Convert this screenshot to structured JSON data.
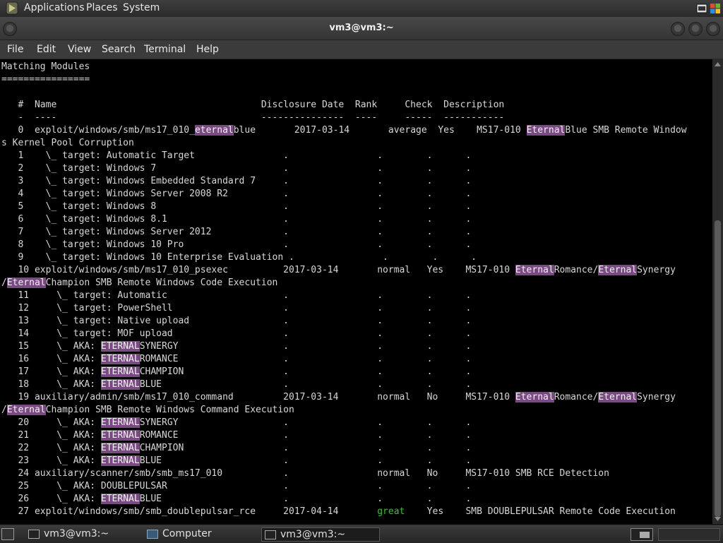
{
  "top_panel": {
    "menus": [
      "Applications",
      "Places",
      "System"
    ]
  },
  "window": {
    "title": "vm3@vm3:~"
  },
  "menubar": {
    "items": [
      "File",
      "Edit",
      "View",
      "Search",
      "Terminal",
      "Help"
    ]
  },
  "terminal": {
    "lines": [
      [
        {
          "t": "Matching Modules"
        }
      ],
      [
        {
          "t": "================"
        }
      ],
      [
        {
          "t": ""
        }
      ],
      [
        {
          "t": "   #  Name                                     Disclosure Date  Rank     Check  Description"
        }
      ],
      [
        {
          "t": "   -  ----                                     ---------------  ----     -----  -----------"
        }
      ],
      [
        {
          "t": "   0  exploit/windows/smb/ms17_010_"
        },
        {
          "t": "eternal",
          "c": "hl"
        },
        {
          "t": "blue       2017-03-14       average  Yes    MS17-010 "
        },
        {
          "t": "Eternal",
          "c": "hl"
        },
        {
          "t": "Blue SMB Remote Window"
        }
      ],
      [
        {
          "t": "s Kernel Pool Corruption"
        }
      ],
      [
        {
          "t": "   1    \\_ target: Automatic Target                .                .        .      ."
        }
      ],
      [
        {
          "t": "   2    \\_ target: Windows 7                       .                .        .      ."
        }
      ],
      [
        {
          "t": "   3    \\_ target: Windows Embedded Standard 7     .                .        .      ."
        }
      ],
      [
        {
          "t": "   4    \\_ target: Windows Server 2008 R2          .                .        .      ."
        }
      ],
      [
        {
          "t": "   5    \\_ target: Windows 8                       .                .        .      ."
        }
      ],
      [
        {
          "t": "   6    \\_ target: Windows 8.1                     .                .        .      ."
        }
      ],
      [
        {
          "t": "   7    \\_ target: Windows Server 2012             .                .        .      ."
        }
      ],
      [
        {
          "t": "   8    \\_ target: Windows 10 Pro                  .                .        .      ."
        }
      ],
      [
        {
          "t": "   9    \\_ target: Windows 10 Enterprise Evaluation .                .        .      ."
        }
      ],
      [
        {
          "t": "   10 exploit/windows/smb/ms17_010_psexec          2017-03-14       normal   Yes    MS17-010 "
        },
        {
          "t": "Eternal",
          "c": "hl"
        },
        {
          "t": "Romance/"
        },
        {
          "t": "Eternal",
          "c": "hl"
        },
        {
          "t": "Synergy"
        }
      ],
      [
        {
          "t": "/"
        },
        {
          "t": "Eternal",
          "c": "hl"
        },
        {
          "t": "Champion SMB Remote Windows Code Execution"
        }
      ],
      [
        {
          "t": "   11     \\_ target: Automatic                     .                .        .      ."
        }
      ],
      [
        {
          "t": "   12     \\_ target: PowerShell                    .                .        .      ."
        }
      ],
      [
        {
          "t": "   13     \\_ target: Native upload                 .                .        .      ."
        }
      ],
      [
        {
          "t": "   14     \\_ target: MOF upload                    .                .        .      ."
        }
      ],
      [
        {
          "t": "   15     \\_ AKA: "
        },
        {
          "t": "ETERNAL",
          "c": "hl"
        },
        {
          "t": "SYNERGY                   .                .        .      ."
        }
      ],
      [
        {
          "t": "   16     \\_ AKA: "
        },
        {
          "t": "ETERNAL",
          "c": "hl"
        },
        {
          "t": "ROMANCE                   .                .        .      ."
        }
      ],
      [
        {
          "t": "   17     \\_ AKA: "
        },
        {
          "t": "ETERNAL",
          "c": "hl"
        },
        {
          "t": "CHAMPION                  .                .        .      ."
        }
      ],
      [
        {
          "t": "   18     \\_ AKA: "
        },
        {
          "t": "ETERNAL",
          "c": "hl"
        },
        {
          "t": "BLUE                      .                .        .      ."
        }
      ],
      [
        {
          "t": "   19 auxiliary/admin/smb/ms17_010_command         2017-03-14       normal   No     MS17-010 "
        },
        {
          "t": "Eternal",
          "c": "hl"
        },
        {
          "t": "Romance/"
        },
        {
          "t": "Eternal",
          "c": "hl"
        },
        {
          "t": "Synergy"
        }
      ],
      [
        {
          "t": "/"
        },
        {
          "t": "Eternal",
          "c": "hl"
        },
        {
          "t": "Champion SMB Remote Windows Command Execution"
        }
      ],
      [
        {
          "t": "   20     \\_ AKA: "
        },
        {
          "t": "ETERNAL",
          "c": "hl"
        },
        {
          "t": "SYNERGY                   .                .        .      ."
        }
      ],
      [
        {
          "t": "   21     \\_ AKA: "
        },
        {
          "t": "ETERNAL",
          "c": "hl"
        },
        {
          "t": "ROMANCE                   .                .        .      ."
        }
      ],
      [
        {
          "t": "   22     \\_ AKA: "
        },
        {
          "t": "ETERNAL",
          "c": "hl"
        },
        {
          "t": "CHAMPION                  .                .        .      ."
        }
      ],
      [
        {
          "t": "   23     \\_ AKA: "
        },
        {
          "t": "ETERNAL",
          "c": "hl"
        },
        {
          "t": "BLUE                      .                .        .      ."
        }
      ],
      [
        {
          "t": "   24 auxiliary/scanner/smb/smb_ms17_010           .                normal   No     MS17-010 SMB RCE Detection"
        }
      ],
      [
        {
          "t": "   25     \\_ AKA: DOUBLEPULSAR                     .                .        .      ."
        }
      ],
      [
        {
          "t": "   26     \\_ AKA: "
        },
        {
          "t": "ETERNAL",
          "c": "hl"
        },
        {
          "t": "BLUE                      .                .        .      ."
        }
      ],
      [
        {
          "t": "   27 exploit/windows/smb/smb_doublepulsar_rce     2017-04-14       "
        },
        {
          "t": "great",
          "c": "grn"
        },
        {
          "t": "    Yes    SMB DOUBLEPULSAR Remote Code Execution"
        }
      ]
    ]
  },
  "taskbar": {
    "items": [
      {
        "label": "vm3@vm3:~",
        "active": false
      },
      {
        "label": "Computer",
        "active": false
      },
      {
        "label": "vm3@vm3:~",
        "active": true
      }
    ]
  },
  "colors": {
    "highlight": "#7a4a82",
    "great_rank": "#3cbf3c",
    "terminal_bg": "#000000",
    "terminal_fg": "#d7d7d7"
  }
}
